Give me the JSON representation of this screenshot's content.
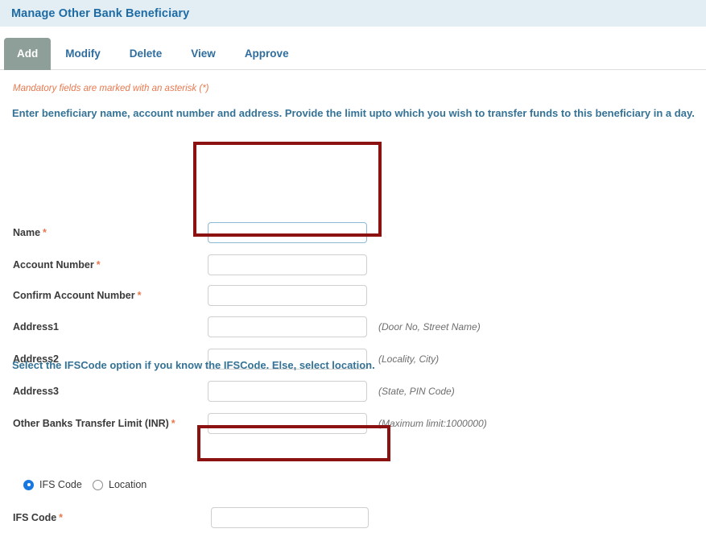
{
  "header": {
    "title": "Manage Other Bank Beneficiary",
    "background_color": "#e2eef3",
    "title_color": "#1d6ba5"
  },
  "tabs": {
    "active_tab": "Add",
    "active_bg_color": "#8e9e99",
    "items": [
      {
        "label": "Add",
        "active": true
      },
      {
        "label": "Modify",
        "active": false
      },
      {
        "label": "Delete",
        "active": false
      },
      {
        "label": "View",
        "active": false
      },
      {
        "label": "Approve",
        "active": false
      }
    ]
  },
  "form": {
    "mandatory_note": "Mandatory fields are marked with an asterisk (*)",
    "mandatory_note_color": "#e8784f",
    "instruction": "Enter beneficiary name, account number and address. Provide the limit upto which you wish to transfer funds to this beneficiary in a day.",
    "instruction_color": "#347296",
    "ifsc_instruction": "Select the IFSCode option if you know the IFSCode. Else, select location.",
    "required_marker": "*",
    "fields": [
      {
        "label": "Name",
        "required": true,
        "value": "",
        "hint": "",
        "focused": true
      },
      {
        "label": "Account Number",
        "required": true,
        "value": "",
        "hint": "",
        "focused": false
      },
      {
        "label": "Confirm Account Number",
        "required": true,
        "value": "",
        "hint": "",
        "focused": false
      },
      {
        "label": "Address1",
        "required": false,
        "value": "",
        "hint": "(Door No, Street Name)",
        "focused": false
      },
      {
        "label": "Address2",
        "required": false,
        "value": "",
        "hint": "(Locality, City)",
        "focused": false
      },
      {
        "label": "Address3",
        "required": false,
        "value": "",
        "hint": "(State, PIN Code)",
        "focused": false
      },
      {
        "label": "Other Banks Transfer Limit (INR)",
        "required": true,
        "value": "",
        "hint": "(Maximum limit:1000000)",
        "focused": false
      }
    ],
    "radio_group": {
      "name": "ifsc-or-location",
      "selected": "IFS Code",
      "selected_color": "#1878e0",
      "options": [
        {
          "label": "IFS Code",
          "checked": true
        },
        {
          "label": "Location",
          "checked": false
        }
      ]
    },
    "ifsc_field": {
      "label": "IFS Code",
      "required": true,
      "value": ""
    }
  },
  "annotations": {
    "color": "#8c1111",
    "boxes": [
      {
        "name": "top-fields-highlight"
      },
      {
        "name": "ifsc-field-highlight"
      }
    ]
  }
}
